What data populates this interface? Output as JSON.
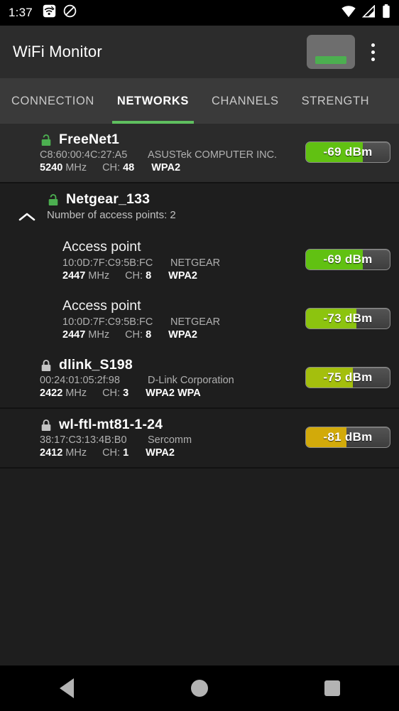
{
  "status_bar": {
    "time": "1:37",
    "left_icons": [
      "wifi-analyzer-icon",
      "do-not-disturb-icon"
    ],
    "right_icons": [
      "wifi-signal-icon",
      "cell-signal-icon",
      "battery-full-icon"
    ]
  },
  "toolbar": {
    "title": "WiFi Monitor",
    "wifi_toggle_name": "wifi-enabled-toggle",
    "overflow_name": "overflow-menu-button",
    "accent": "#4caf50"
  },
  "tabs": {
    "items": [
      {
        "label": "CONNECTION",
        "active": false
      },
      {
        "label": "NETWORKS",
        "active": true
      },
      {
        "label": "CHANNELS",
        "active": false
      },
      {
        "label": "STRENGTH",
        "active": false
      }
    ],
    "indicator_color": "#5fbf5f"
  },
  "networks": [
    {
      "type": "network",
      "ssid": "FreeNet1",
      "lock": "unlocked",
      "lock_color": "#4caf50",
      "mac": "C8:60:00:4C:27:A5",
      "vendor": "ASUSTek COMPUTER INC.",
      "frequency": "5240",
      "frequency_unit": "MHz",
      "channel_label": "CH:",
      "channel": "48",
      "security": "WPA2",
      "signal": "-69 dBm",
      "signal_dbm": -69,
      "fill_percent": 68,
      "fill_color": "#5cb811",
      "highlight": true,
      "expandable": false
    },
    {
      "type": "group",
      "ssid": "Netgear_133",
      "lock": "unlocked",
      "lock_color": "#4caf50",
      "sub_text": "Number of access points: 2",
      "expanded": true,
      "chevron": "chevron-up-icon",
      "access_points": [
        {
          "title": "Access point",
          "mac": "10:0D:7F:C9:5B:FC",
          "vendor": "NETGEAR",
          "frequency": "2447",
          "frequency_unit": "MHz",
          "channel_label": "CH:",
          "channel": "8",
          "security": "WPA2",
          "signal": "-69 dBm",
          "signal_dbm": -69,
          "fill_percent": 68,
          "fill_color": "#5cb811"
        },
        {
          "title": "Access point",
          "mac": "10:0D:7F:C9:5B:FC",
          "vendor": "NETGEAR",
          "frequency": "2447",
          "frequency_unit": "MHz",
          "channel_label": "CH:",
          "channel": "8",
          "security": "WPA2",
          "signal": "-73 dBm",
          "signal_dbm": -73,
          "fill_percent": 60,
          "fill_color": "#85bb0e"
        }
      ]
    },
    {
      "type": "network",
      "ssid": "dlink_S198",
      "lock": "locked",
      "lock_color": "#c4c4c4",
      "mac": "00:24:01:05:2f:98",
      "vendor": "D-Link Corporation",
      "frequency": "2422",
      "frequency_unit": "MHz",
      "channel_label": "CH:",
      "channel": "3",
      "security": "WPA2 WPA",
      "signal": "-75 dBm",
      "signal_dbm": -75,
      "fill_percent": 56,
      "fill_color": "#9cb60c",
      "highlight": false,
      "expandable": false
    },
    {
      "type": "network",
      "ssid": "wl-ftl-mt81-1-24",
      "lock": "locked",
      "lock_color": "#c4c4c4",
      "mac": "38:17:C3:13:4B:B0",
      "vendor": "Sercomm",
      "frequency": "2412",
      "frequency_unit": "MHz",
      "channel_label": "CH:",
      "channel": "1",
      "security": "WPA2",
      "signal": "-81 dBm",
      "signal_dbm": -81,
      "fill_percent": 48,
      "fill_color": "#c8a20a",
      "highlight": false,
      "expandable": false
    }
  ],
  "nav_bar": {
    "back": "back-triangle-icon",
    "home": "home-circle-icon",
    "recents": "recents-square-icon"
  }
}
